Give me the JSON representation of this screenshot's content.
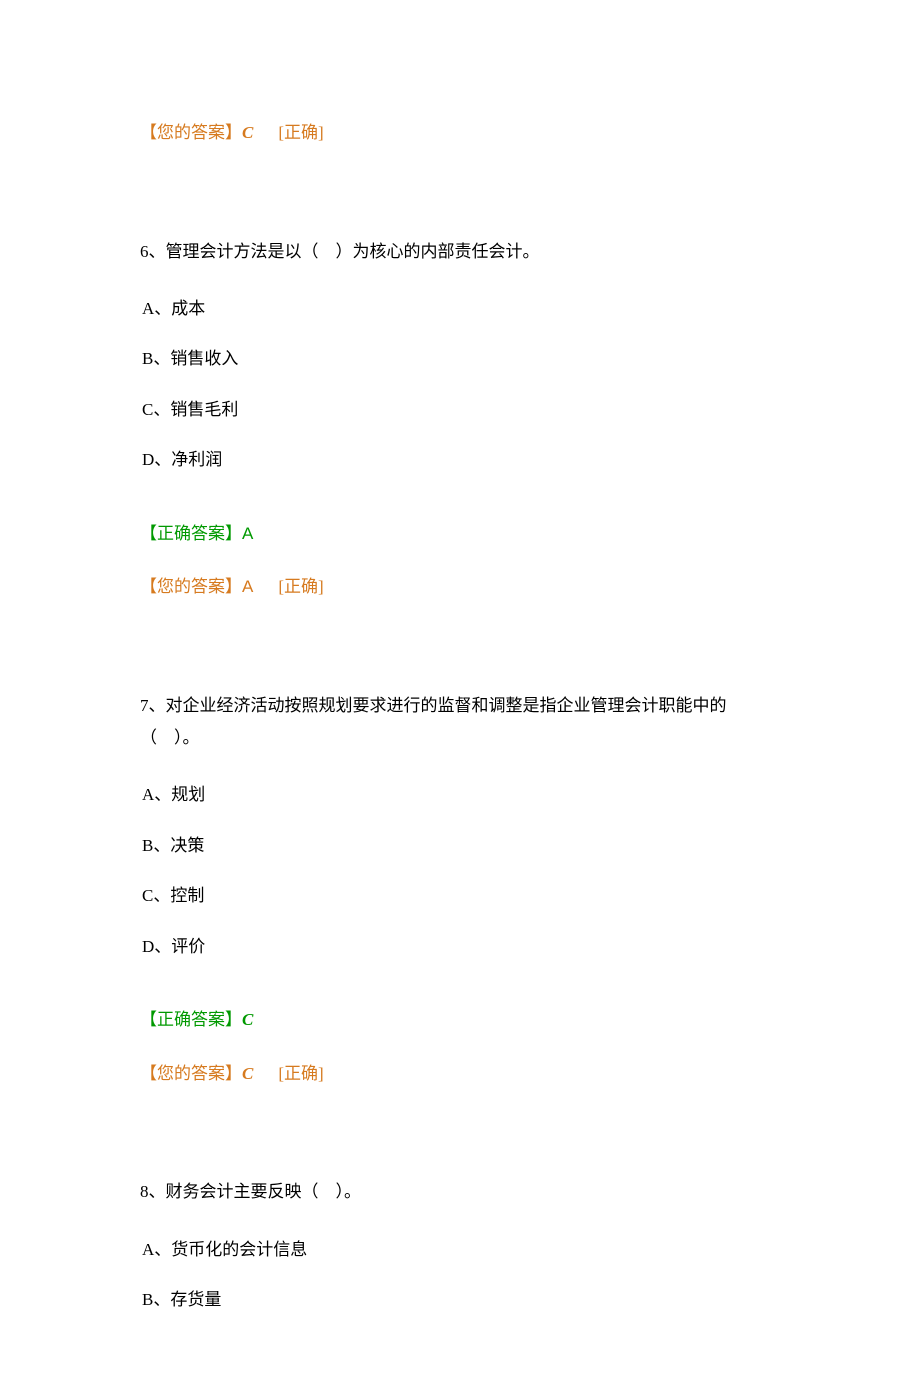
{
  "prev_your_answer_label": "【您的答案】",
  "prev_your_answer_value": "C",
  "prev_status": "[正确]",
  "q6": {
    "stem": "6、管理会计方法是以（　）为核心的内部责任会计。",
    "optA": "A、成本",
    "optB": "B、销售收入",
    "optC": "C、销售毛利",
    "optD": "D、净利润",
    "correct_label": "【正确答案】",
    "correct_value": "A",
    "your_label": "【您的答案】",
    "your_value": "A",
    "status": "[正确]"
  },
  "q7": {
    "stem": "7、对企业经济活动按照规划要求进行的监督和调整是指企业管理会计职能中的（　）。",
    "optA": "A、规划",
    "optB": "B、决策",
    "optC": "C、控制",
    "optD": "D、评价",
    "correct_label": "【正确答案】",
    "correct_value": "C",
    "your_label": "【您的答案】",
    "your_value": "C",
    "status": "[正确]"
  },
  "q8": {
    "stem": "8、财务会计主要反映（　）。",
    "optA": "A、货币化的会计信息",
    "optB": "B、存货量"
  }
}
